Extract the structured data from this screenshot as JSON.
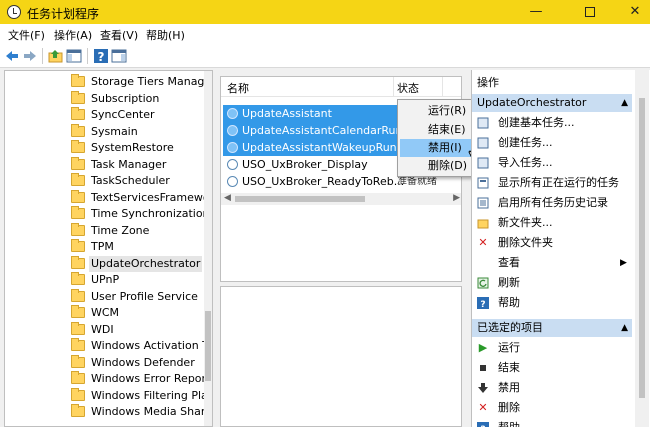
{
  "window": {
    "title": "任务计划程序"
  },
  "menu": [
    "文件(F)",
    "操作(A)",
    "查看(V)",
    "帮助(H)"
  ],
  "toolbar": {
    "buttons": [
      "back-icon",
      "forward-icon",
      "up-folder-icon",
      "show-hide-console-tree-icon",
      "help-icon",
      "show-hide-action-pane-icon"
    ]
  },
  "tree": {
    "items": [
      "Storage Tiers Manager",
      "Subscription",
      "SyncCenter",
      "Sysmain",
      "SystemRestore",
      "Task Manager",
      "TaskScheduler",
      "TextServicesFramework",
      "Time Synchronization",
      "Time Zone",
      "TPM",
      "UpdateOrchestrator",
      "UPnP",
      "User Profile Service",
      "WCM",
      "WDI",
      "Windows Activation Te",
      "Windows Defender",
      "Windows Error Report",
      "Windows Filtering Platf",
      "Windows Media Sharir"
    ],
    "selected": "UpdateOrchestrator"
  },
  "tasks": {
    "columns": [
      "名称",
      "状态"
    ],
    "rows": [
      {
        "name": "UpdateAssistant",
        "status": ""
      },
      {
        "name": "UpdateAssistantCalendarRun",
        "status": ""
      },
      {
        "name": "UpdateAssistantWakeupRun",
        "status": ""
      },
      {
        "name": "USO_UxBroker_Display",
        "status": ""
      },
      {
        "name": "USO_UxBroker_ReadyToReb...",
        "status": "准备就绪"
      }
    ]
  },
  "context_menu": {
    "items": [
      "运行(R)",
      "结束(E)",
      "禁用(I)",
      "删除(D)"
    ],
    "highlighted": "禁用(I)"
  },
  "actions": {
    "header": "操作",
    "section1": {
      "title": "UpdateOrchestrator",
      "items": [
        {
          "icon": "create-basic-task-icon",
          "label": "创建基本任务..."
        },
        {
          "icon": "create-task-icon",
          "label": "创建任务..."
        },
        {
          "icon": "import-task-icon",
          "label": "导入任务..."
        },
        {
          "icon": "running-tasks-icon",
          "label": "显示所有正在运行的任务"
        },
        {
          "icon": "history-icon",
          "label": "启用所有任务历史记录"
        },
        {
          "icon": "new-folder-icon",
          "label": "新文件夹..."
        },
        {
          "icon": "delete-folder-icon",
          "label": "删除文件夹"
        },
        {
          "icon": "view-icon",
          "label": "查看"
        },
        {
          "icon": "refresh-icon",
          "label": "刷新"
        },
        {
          "icon": "help-icon",
          "label": "帮助"
        }
      ]
    },
    "section2": {
      "title": "已选定的项目",
      "items": [
        {
          "icon": "run-icon",
          "label": "运行"
        },
        {
          "icon": "end-icon",
          "label": "结束"
        },
        {
          "icon": "disable-icon",
          "label": "禁用"
        },
        {
          "icon": "delete-icon",
          "label": "删除"
        },
        {
          "icon": "help-icon",
          "label": "帮助"
        }
      ]
    }
  },
  "colors": {
    "titlebar": "#f5d515",
    "selection": "#3399e8",
    "section_header": "#c9ddf2",
    "menu_highlight": "#91c9f7"
  }
}
